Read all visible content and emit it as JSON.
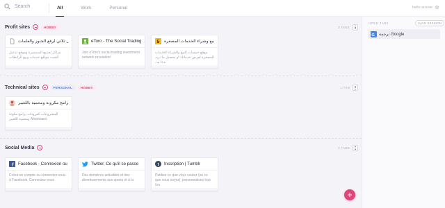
{
  "topbar": {
    "search_placeholder": "Search",
    "tabs": [
      {
        "label": "All",
        "active": true
      },
      {
        "label": "Work",
        "active": false
      },
      {
        "label": "Personal",
        "active": false
      }
    ],
    "user_label": "hello.aussie"
  },
  "sections": [
    {
      "title": "Profit sites",
      "tags": [
        {
          "text": "HOBBY",
          "color": "pink"
        }
      ],
      "count": "3 TABS",
      "cards": [
        {
          "title": "دليل ثلاثي لرفع الجبور والعلمات",
          "icon": "page-icon",
          "desc": "مراكز تجميع السمسرة وموقع تدعيل الجيت مواقع خدمات وبيع الرابطات"
        },
        {
          "title": "eToro - The Social Trading",
          "icon": "etoro-icon",
          "desc": "Join eToro's social trading investment network revolution!"
        },
        {
          "title": "شبكة بيع وشراء الخدمات المصغرة",
          "icon": "khamsat-icon",
          "desc": "موقع خمسات للبيع والشراء الخدمات المصغرة لعرض خدماتك او تحصيل ما تريد بدءا من"
        }
      ]
    },
    {
      "title": "Technical sites",
      "tags": [
        {
          "text": "PERSONAL",
          "color": "blue"
        },
        {
          "text": "HOBBY",
          "color": "pink"
        }
      ],
      "count": "1 TAB",
      "cards": [
        {
          "title": "برامج مكرونة ومحمية باللغيبر",
          "icon": "avatar-icon",
          "desc": "المشروعات كمرونات برامج مكونة ومحمية اللغيبر Altootoard"
        }
      ]
    },
    {
      "title": "Social Media",
      "tags": [],
      "count": "3 TABS",
      "cards": [
        {
          "title": "Facebook - Connexion ou",
          "icon": "facebook-icon",
          "desc": "Créez un compte ou connectez-vous à Facebook. Connectez-vous"
        },
        {
          "title": "Twitter. Ce qu'il se passe",
          "icon": "twitter-icon",
          "desc": "Des dernières actualités et des divertissements aux sports et à la"
        },
        {
          "title": "Inscription | Tumblr",
          "icon": "tumblr-icon",
          "desc": "Publiez ce que vous voulez (ou ce que vous soyez), personnalisez tout (ou"
        }
      ]
    }
  ],
  "sidebar": {
    "label": "OPEN TABS",
    "save_button": "SAVE SESSION",
    "open_tab": {
      "title": "ترجمة Google",
      "icon": "google-translate-icon"
    }
  },
  "colors": {
    "accent": "#e0467a",
    "tag_blue": "#5b7bd8"
  }
}
